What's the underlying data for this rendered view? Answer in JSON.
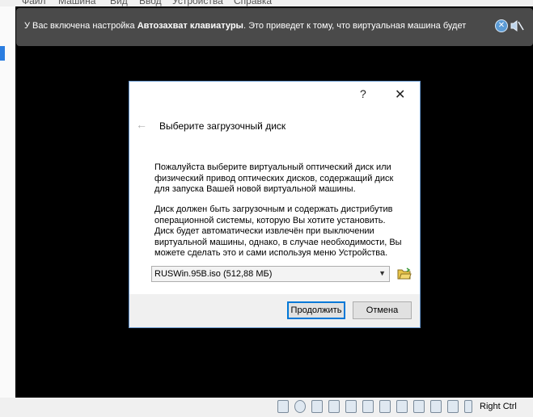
{
  "menu": [
    "Файл",
    "Машина",
    "Вид",
    "Ввод",
    "Устройства",
    "Справка"
  ],
  "notification": {
    "text_before": "У Вас включена настройка ",
    "text_bold": "Автозахват клавиатуры",
    "text_after": ". Это приведет к тому, что виртуальная машина будет",
    "info_icon": "info-icon",
    "mute_icon": "mute-icon"
  },
  "dialog": {
    "help": "?",
    "close": "✕",
    "back": "←",
    "title": "Выберите загрузочный диск",
    "paragraph1_lines": [
      "Пожалуйста выберите виртуальный оптический диск или",
      "физический привод оптических дисков, содержащий диск",
      "для запуска Вашей новой виртуальной машины."
    ],
    "paragraph2_lines": [
      "Диск должен быть загрузочным и содержать дистрибутив",
      "операционной системы, которую Вы хотите установить.",
      "Диск будет автоматически извлечён при выключении",
      "виртуальной машины, однако, в случае необходимости, Вы",
      "можете сделать это и сами используя меню Устройства."
    ],
    "combo_value": "RUSWin.95B.iso (512,88 МБ)",
    "continue_label": "Продолжить",
    "cancel_label": "Отмена"
  },
  "statusbar": {
    "icons": [
      "cd-icon",
      "optical-drive-icon",
      "floppy-icon",
      "network-icon",
      "usb-icon",
      "pen-icon",
      "folder-icon",
      "display-icon",
      "capture-icon",
      "recording-icon",
      "cpu-icon",
      "mouse-icon",
      "keyboard-arrow-icon"
    ],
    "host_key": "Right Ctrl"
  },
  "colors": {
    "accent": "#0078d7",
    "notify_bg": "#4a4a4a",
    "vm_bg": "#000000"
  }
}
